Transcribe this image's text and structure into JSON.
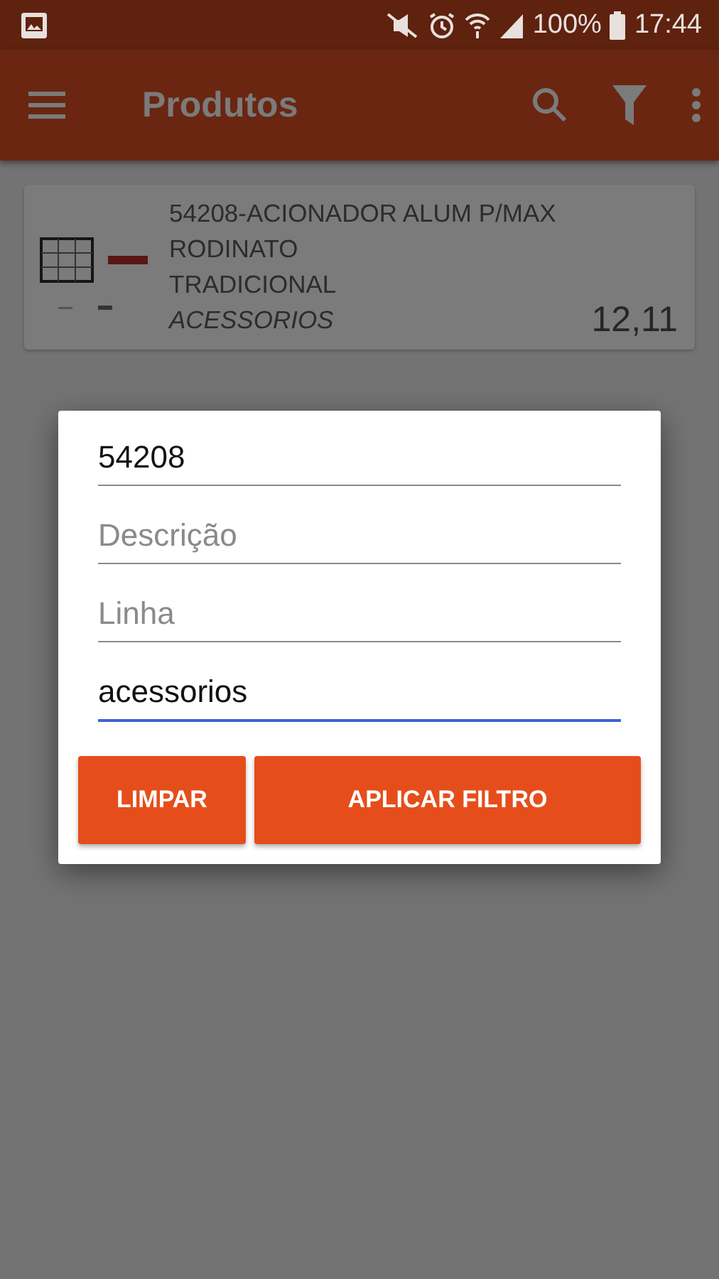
{
  "status_bar": {
    "battery": "100%",
    "time": "17:44"
  },
  "app_bar": {
    "title": "Produtos"
  },
  "products": [
    {
      "name": "54208-ACIONADOR ALUM P/MAX RODINATO",
      "line": "TRADICIONAL",
      "category": "ACESSORIOS",
      "price": "12,11"
    }
  ],
  "filter_dialog": {
    "fields": [
      {
        "value": "54208",
        "focused": false
      },
      {
        "placeholder": "Descrição",
        "focused": false
      },
      {
        "placeholder": "Linha",
        "focused": false
      },
      {
        "value": "acessorios",
        "focused": true
      }
    ],
    "buttons": [
      "LIMPAR",
      "APLICAR FILTRO"
    ]
  }
}
